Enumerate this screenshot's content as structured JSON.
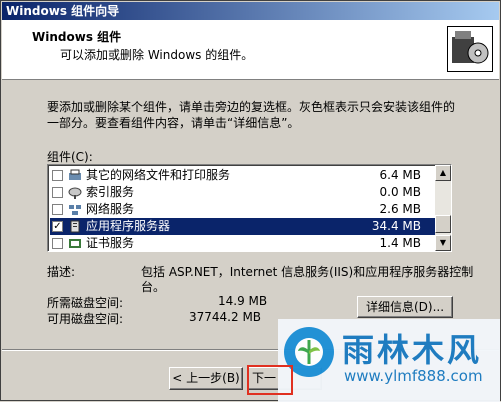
{
  "window": {
    "title": "Windows 组件向导"
  },
  "header": {
    "title": "Windows 组件",
    "subtitle": "可以添加或删除 Windows 的组件。"
  },
  "description": {
    "line1": "要添加或删除某个组件，请单击旁边的复选框。灰色框表示只会安装该组件的",
    "line2": "一部分。要查看组件内容，请单击“详细信息”。"
  },
  "components": {
    "label": "组件(C):",
    "items": [
      {
        "name": "其它的网络文件和打印服务",
        "size": "6.4 MB",
        "checked": false,
        "icon": "network-printer-icon"
      },
      {
        "name": "索引服务",
        "size": "0.0 MB",
        "checked": false,
        "icon": "search-index-icon"
      },
      {
        "name": "网络服务",
        "size": "2.6 MB",
        "checked": false,
        "icon": "network-icon"
      },
      {
        "name": "应用程序服务器",
        "size": "34.4 MB",
        "checked": true,
        "selected": true,
        "icon": "app-server-icon"
      },
      {
        "name": "证书服务",
        "size": "1.4 MB",
        "checked": false,
        "icon": "certificate-icon"
      }
    ]
  },
  "info": {
    "desc_label": "描述:",
    "desc_line1": "包括 ASP.NET，Internet 信息服务(IIS)和应用程序服务器控制",
    "desc_line2": "台。",
    "required_label": "所需磁盘空间:",
    "required_value": "14.9 MB",
    "available_label": "可用磁盘空间:",
    "available_value": "37744.2 MB"
  },
  "buttons": {
    "details": "详细信息(D)...",
    "back": "< 上一步(B)",
    "next": "下一"
  },
  "watermark": {
    "title": "雨林木风",
    "url": "www.ylmf888.com"
  },
  "colors": {
    "title_bar": "#0a246a",
    "selection": "#0a246a",
    "watermark": "#1a7ac0",
    "highlight_box": "#e03020"
  }
}
